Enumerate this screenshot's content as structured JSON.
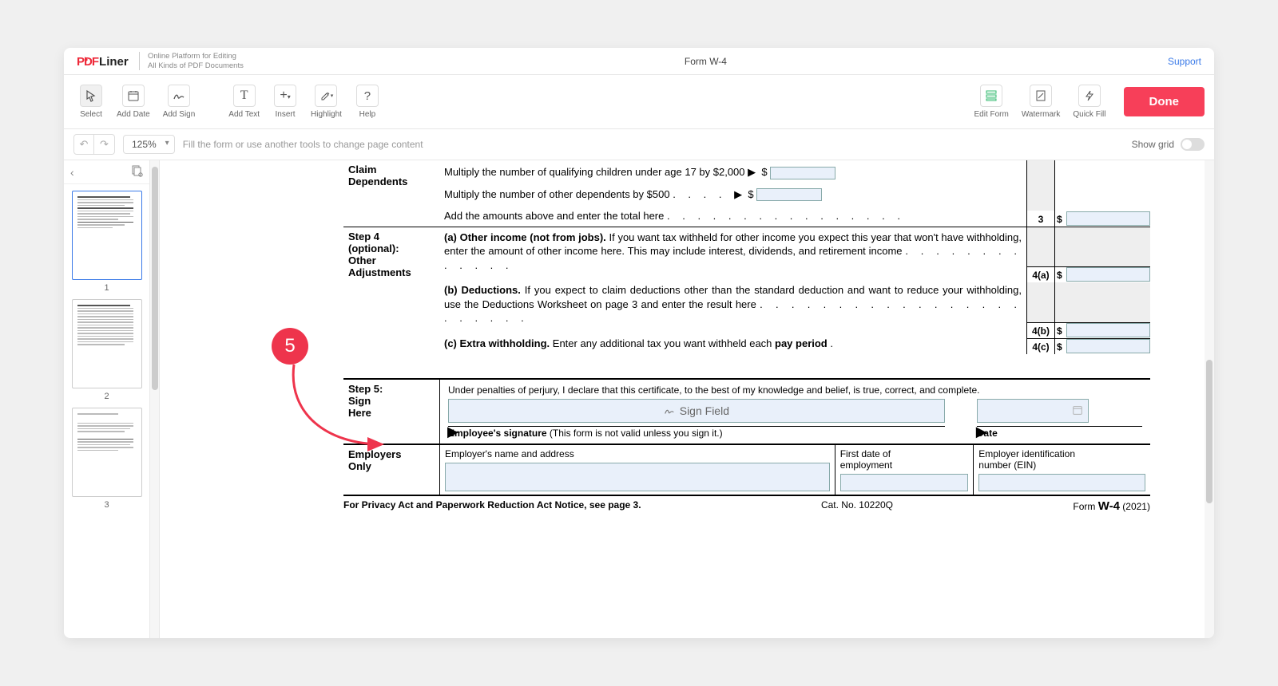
{
  "brand": {
    "name": "PDFLiner",
    "sub1": "Online Platform for Editing",
    "sub2": "All Kinds of PDF Documents"
  },
  "doc": {
    "title": "Form W-4"
  },
  "support": "Support",
  "tools": {
    "select": "Select",
    "addDate": "Add Date",
    "addSign": "Add Sign",
    "addText": "Add Text",
    "insert": "Insert",
    "highlight": "Highlight",
    "help": "Help",
    "editForm": "Edit Form",
    "watermark": "Watermark",
    "quickFill": "Quick Fill",
    "done": "Done"
  },
  "subbar": {
    "zoom": "125%",
    "hint": "Fill the form or use another tools to change page content",
    "showGrid": "Show grid"
  },
  "pages": {
    "p1": "1",
    "p2": "2",
    "p3": "3"
  },
  "callout": {
    "num": "5"
  },
  "w4": {
    "claim": {
      "head1": "Claim",
      "head2": "Dependents",
      "l1a": "Multiply the number of qualifying children under age 17 by $2,000 ▶",
      "l1b": "Multiply the number of other dependents by $500",
      "l2": "Add the amounts above and enter the total here",
      "n3": "3"
    },
    "step4": {
      "head1": "Step 4",
      "head2": "(optional):",
      "head3": "Other",
      "head4": "Adjustments",
      "a_bold": "(a)  Other income (not from jobs).",
      "a_rest": " If you want tax withheld for other income you expect this year that won't have withholding, enter the amount of other income here. This may include interest, dividends, and retirement income",
      "a_n": "4(a)",
      "b_bold": "(b)  Deductions.",
      "b_rest": " If you expect to claim deductions other than the standard deduction and want to reduce your withholding, use the Deductions Worksheet on page 3 and enter the result here",
      "b_n": "4(b)",
      "c_bold": "(c)  Extra withholding.",
      "c_rest": " Enter any additional tax you want withheld each ",
      "c_bold2": "pay period",
      "c_n": "4(c)"
    },
    "step5": {
      "head1": "Step 5:",
      "head2": "Sign",
      "head3": "Here",
      "decl": "Under penalties of perjury, I declare that this certificate, to the best of my knowledge and belief, is true, correct, and complete.",
      "signField": "Sign Field",
      "sigLabel_b": "Employee's signature",
      "sigLabel_r": " (This form is not valid unless you sign it.)",
      "date": "Date"
    },
    "emp": {
      "head1": "Employers",
      "head2": "Only",
      "c1": "Employer's name and address",
      "c2a": "First date of",
      "c2b": "employment",
      "c3a": "Employer identification",
      "c3b": "number (EIN)"
    },
    "foot": {
      "l": "For Privacy Act and Paperwork Reduction Act Notice, see page 3.",
      "m": "Cat. No. 10220Q",
      "r1": "Form ",
      "r2": "W-4",
      "r3": " (2021)"
    }
  }
}
